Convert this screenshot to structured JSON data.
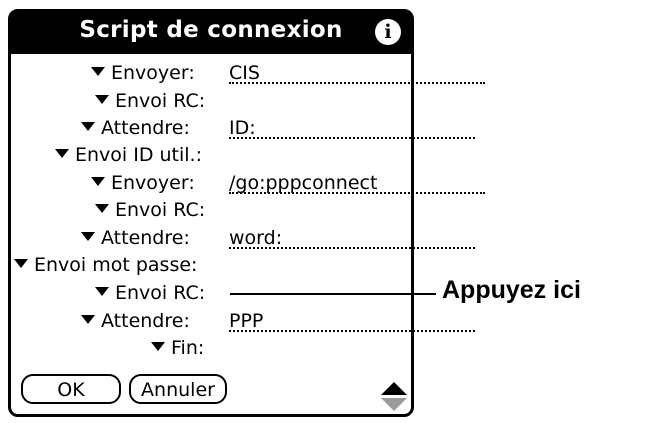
{
  "dialog": {
    "title": "Script de connexion",
    "info_icon": "info-icon"
  },
  "script_rows": [
    {
      "label": "Envoyer:",
      "value": "CIS"
    },
    {
      "label": "Envoi RC:",
      "value": ""
    },
    {
      "label": "Attendre:",
      "value": "ID:"
    },
    {
      "label": "Envoi ID util.:",
      "value": ""
    },
    {
      "label": "Envoyer:",
      "value": "/go:pppconnect"
    },
    {
      "label": "Envoi RC:",
      "value": ""
    },
    {
      "label": "Attendre:",
      "value": "word:"
    },
    {
      "label": "Envoi mot passe:",
      "value": ""
    },
    {
      "label": "Envoi RC:",
      "value": ""
    },
    {
      "label": "Attendre:",
      "value": "PPP"
    },
    {
      "label": "Fin:",
      "value": ""
    }
  ],
  "buttons": {
    "ok": "OK",
    "cancel": "Annuler"
  },
  "callout": {
    "text": "Appuyez ici"
  }
}
